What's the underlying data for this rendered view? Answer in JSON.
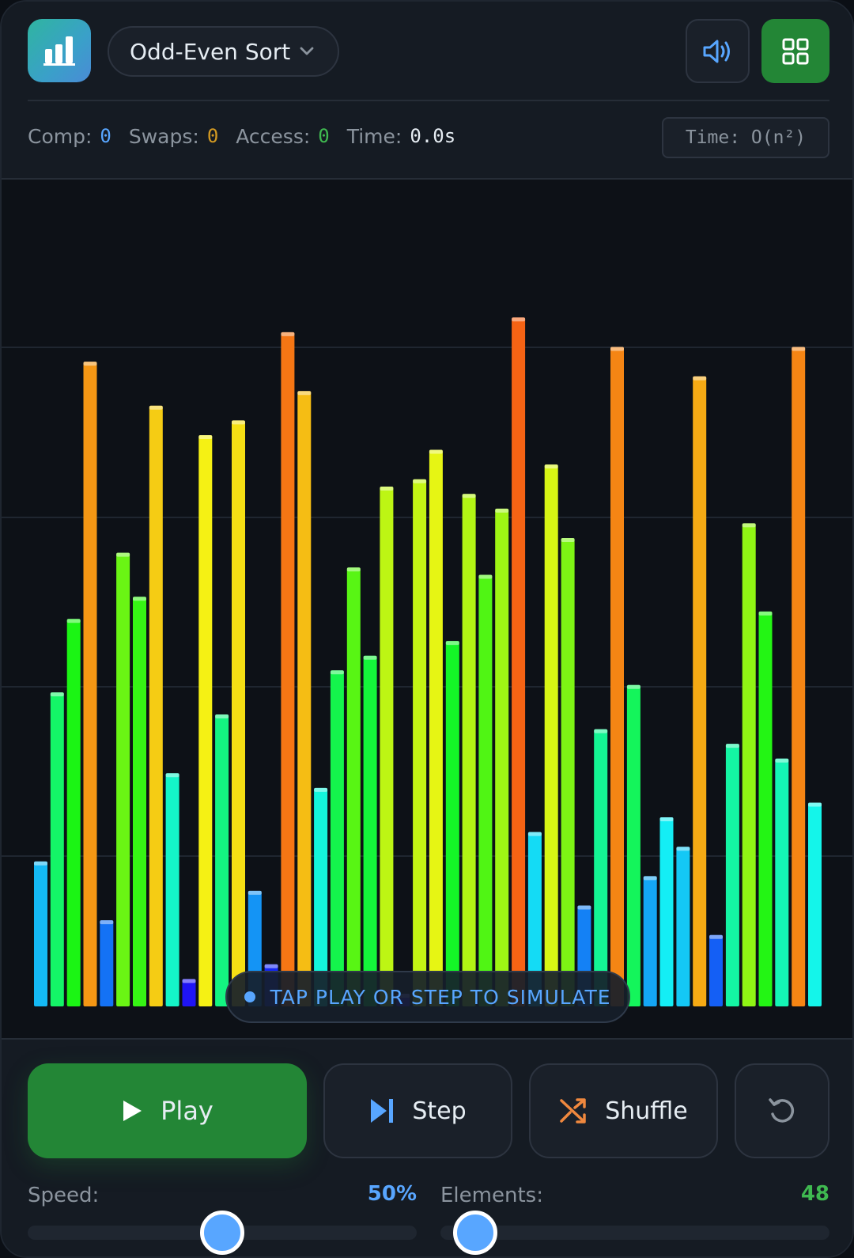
{
  "header": {
    "logo_icon": "bar-chart-icon",
    "algorithm": "Odd-Even Sort",
    "sound_icon": "speaker-icon",
    "grid_icon": "grid-icon"
  },
  "stats": {
    "comp_label": "Comp:",
    "comp_value": "0",
    "swaps_label": "Swaps:",
    "swaps_value": "0",
    "access_label": "Access:",
    "access_value": "0",
    "time_label": "Time:",
    "time_value": "0.0s",
    "complexity": "Time: O(n²)"
  },
  "hint": "TAP PLAY OR STEP TO SIMULATE",
  "controls": {
    "play_label": "Play",
    "step_label": "Step",
    "shuffle_label": "Shuffle",
    "reset_icon": "reset-icon"
  },
  "speed": {
    "label": "Speed:",
    "value_text": "50%",
    "fraction": 0.5
  },
  "elements": {
    "label": "Elements:",
    "value_text": "48",
    "fraction": 0.09
  },
  "colors": {
    "accent_blue": "#58a6ff",
    "play_green": "#238636"
  },
  "chart_data": {
    "type": "bar",
    "ylim": [
      0,
      100
    ],
    "grid": true,
    "values": [
      18,
      41,
      51,
      86,
      10,
      60,
      54,
      80,
      30,
      2,
      76,
      38,
      78,
      14,
      4,
      90,
      82,
      28,
      44,
      58,
      46,
      69,
      0,
      70,
      74,
      48,
      68,
      57,
      66,
      92,
      22,
      72,
      62,
      12,
      36,
      88,
      42,
      16,
      24,
      20,
      84,
      8,
      34,
      64,
      52,
      32,
      88,
      26
    ]
  }
}
